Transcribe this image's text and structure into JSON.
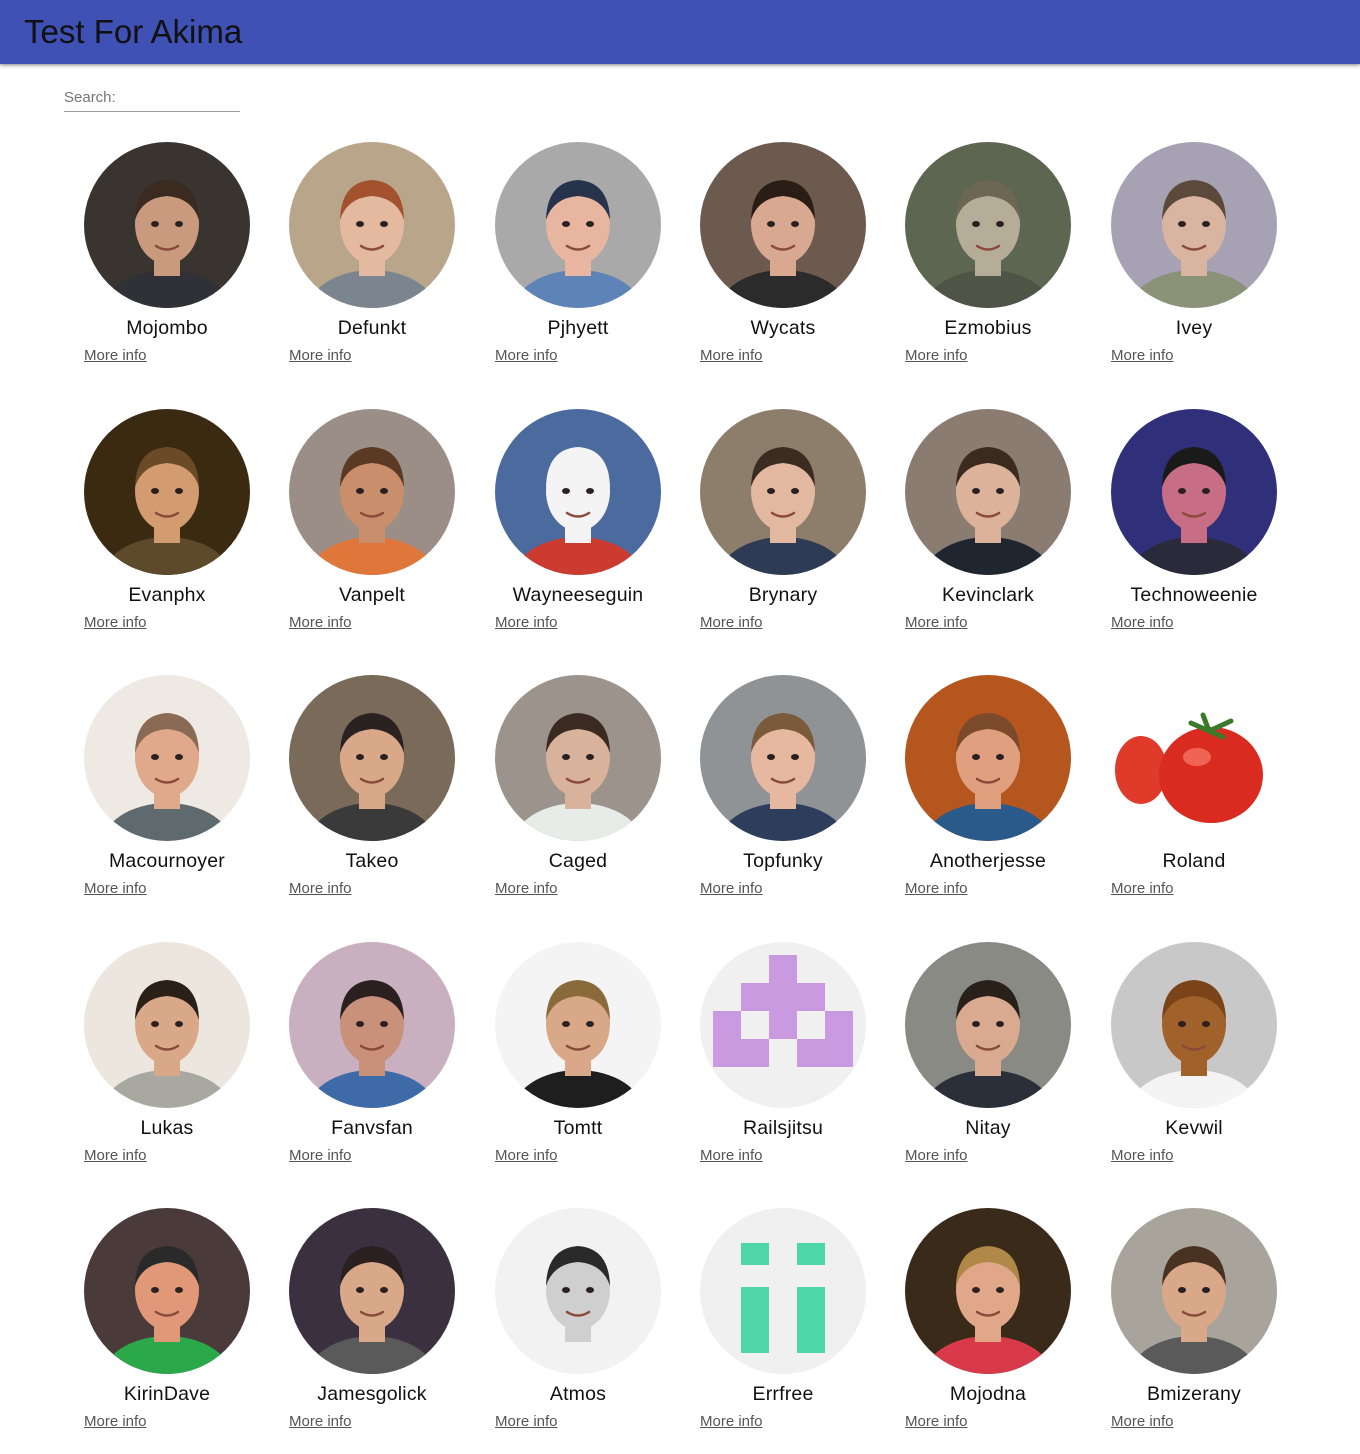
{
  "app_bar": {
    "title": "Test For Akima",
    "color": "#3f51b5"
  },
  "search": {
    "placeholder": "Search:",
    "value": ""
  },
  "users": [
    {
      "name": "Mojombo",
      "link": "More info",
      "avatar": {
        "bg": "#3a3430",
        "skin": "#c99a7e",
        "hair": "#3b2a20",
        "shirt": "#2f3136"
      }
    },
    {
      "name": "Defunkt",
      "link": "More info",
      "avatar": {
        "bg": "#b9a58a",
        "skin": "#e3b9a0",
        "hair": "#a4512e",
        "shirt": "#7b8590"
      }
    },
    {
      "name": "Pjhyett",
      "link": "More info",
      "avatar": {
        "bg": "#a9a9a9",
        "skin": "#e8b6a0",
        "hair": "#27334a",
        "shirt": "#5e84b7"
      }
    },
    {
      "name": "Wycats",
      "link": "More info",
      "avatar": {
        "bg": "#6d5a4f",
        "skin": "#d9a890",
        "hair": "#2a1d15",
        "shirt": "#2b2b2b"
      }
    },
    {
      "name": "Ezmobius",
      "link": "More info",
      "avatar": {
        "bg": "#5c6650",
        "skin": "#b6ad98",
        "hair": "#6c6752",
        "shirt": "#4e5546"
      }
    },
    {
      "name": "Ivey",
      "link": "More info",
      "avatar": {
        "bg": "#a7a2b3",
        "skin": "#d9b4a0",
        "hair": "#5b4a3c",
        "shirt": "#8a9277"
      }
    },
    {
      "name": "Evanphx",
      "link": "More info",
      "avatar": {
        "bg": "#3a2a12",
        "skin": "#d29b70",
        "hair": "#6b4a28",
        "shirt": "#5c4a2a"
      }
    },
    {
      "name": "Vanpelt",
      "link": "More info",
      "avatar": {
        "bg": "#9a8e86",
        "skin": "#c98e6b",
        "hair": "#5a3a22",
        "shirt": "#e0773a"
      }
    },
    {
      "name": "Wayneeseguin",
      "link": "More info",
      "avatar": {
        "bg": "#4b6b9e",
        "skin": "#f4f4f4",
        "hair": "#f4f4f4",
        "shirt": "#cc3b2f"
      }
    },
    {
      "name": "Brynary",
      "link": "More info",
      "avatar": {
        "bg": "#8d7e6c",
        "skin": "#e2b8a0",
        "hair": "#3b2c22",
        "shirt": "#2d3b55"
      }
    },
    {
      "name": "Kevinclark",
      "link": "More info",
      "avatar": {
        "bg": "#8a7c70",
        "skin": "#dcb29a",
        "hair": "#3b2a1e",
        "shirt": "#1f2630"
      }
    },
    {
      "name": "Technoweenie",
      "link": "More info",
      "avatar": {
        "bg": "#2f2f7a",
        "skin": "#c76e86",
        "hair": "#1a1a1a",
        "shirt": "#2a2a3a"
      }
    },
    {
      "name": "Macournoyer",
      "link": "More info",
      "avatar": {
        "bg": "#efe9e4",
        "skin": "#e0a98c",
        "hair": "#8a6a55",
        "shirt": "#5e6a6e"
      }
    },
    {
      "name": "Takeo",
      "link": "More info",
      "avatar": {
        "bg": "#7a6a5a",
        "skin": "#d9a888",
        "hair": "#2a2220",
        "shirt": "#3a3a3a"
      }
    },
    {
      "name": "Caged",
      "link": "More info",
      "avatar": {
        "bg": "#9c948c",
        "skin": "#d9b29c",
        "hair": "#3a2a22",
        "shirt": "#e8ece8"
      }
    },
    {
      "name": "Topfunky",
      "link": "More info",
      "avatar": {
        "bg": "#8f9396",
        "skin": "#e6b8a0",
        "hair": "#7a5a3a",
        "shirt": "#2c3e5c"
      }
    },
    {
      "name": "Anotherjesse",
      "link": "More info",
      "avatar": {
        "bg": "#b6561f",
        "skin": "#e0a080",
        "hair": "#7a4a2a",
        "shirt": "#2a5a8a"
      }
    },
    {
      "name": "Roland",
      "link": "More info",
      "avatar": {
        "bg": "#ffffff",
        "skin": "#d92b1f",
        "hair": "#3a7a2a",
        "shirt": "#e83a2a"
      }
    },
    {
      "name": "Lukas",
      "link": "More info",
      "avatar": {
        "bg": "#ece6de",
        "skin": "#d9a888",
        "hair": "#2a2018",
        "shirt": "#a8a8a0"
      }
    },
    {
      "name": "Fanvsfan",
      "link": "More info",
      "avatar": {
        "bg": "#c8b0c0",
        "skin": "#c9907a",
        "hair": "#2a2020",
        "shirt": "#3f6aa8"
      }
    },
    {
      "name": "Tomtt",
      "link": "More info",
      "avatar": {
        "bg": "#f4f4f4",
        "skin": "#d9a888",
        "hair": "#8a6a3a",
        "shirt": "#1e1e1e"
      }
    },
    {
      "name": "Railsjitsu",
      "link": "More info",
      "avatar": {
        "bg": "#f0f0f0",
        "skin": "#c99ae0",
        "hair": "#c99ae0",
        "shirt": "#c99ae0"
      }
    },
    {
      "name": "Nitay",
      "link": "More info",
      "avatar": {
        "bg": "#8a8a84",
        "skin": "#d9aa90",
        "hair": "#2a201a",
        "shirt": "#2a2f3a"
      }
    },
    {
      "name": "Kevwil",
      "link": "More info",
      "avatar": {
        "bg": "#c8c8c8",
        "skin": "#a0622a",
        "hair": "#7a4418",
        "shirt": "#f4f4f4"
      }
    },
    {
      "name": "KirinDave",
      "link": "More info",
      "avatar": {
        "bg": "#4a3a3a",
        "skin": "#e09878",
        "hair": "#2a2a2a",
        "shirt": "#2aa84a"
      }
    },
    {
      "name": "Jamesgolick",
      "link": "More info",
      "avatar": {
        "bg": "#3a3040",
        "skin": "#d9a888",
        "hair": "#2a2020",
        "shirt": "#5a5a5a"
      }
    },
    {
      "name": "Atmos",
      "link": "More info",
      "avatar": {
        "bg": "#f2f2f2",
        "skin": "#cfcfcf",
        "hair": "#2a2a2a",
        "shirt": "#f2f2f2"
      }
    },
    {
      "name": "Errfree",
      "link": "More info",
      "avatar": {
        "bg": "#f0f0f0",
        "skin": "#4fd6a8",
        "hair": "#4fd6a8",
        "shirt": "#4fd6a8"
      }
    },
    {
      "name": "Mojodna",
      "link": "More info",
      "avatar": {
        "bg": "#3a2a1a",
        "skin": "#e0a888",
        "hair": "#b08848",
        "shirt": "#d83a4a"
      }
    },
    {
      "name": "Bmizerany",
      "link": "More info",
      "avatar": {
        "bg": "#a8a49c",
        "skin": "#d9a888",
        "hair": "#4a3222",
        "shirt": "#5a5a5a"
      }
    }
  ]
}
